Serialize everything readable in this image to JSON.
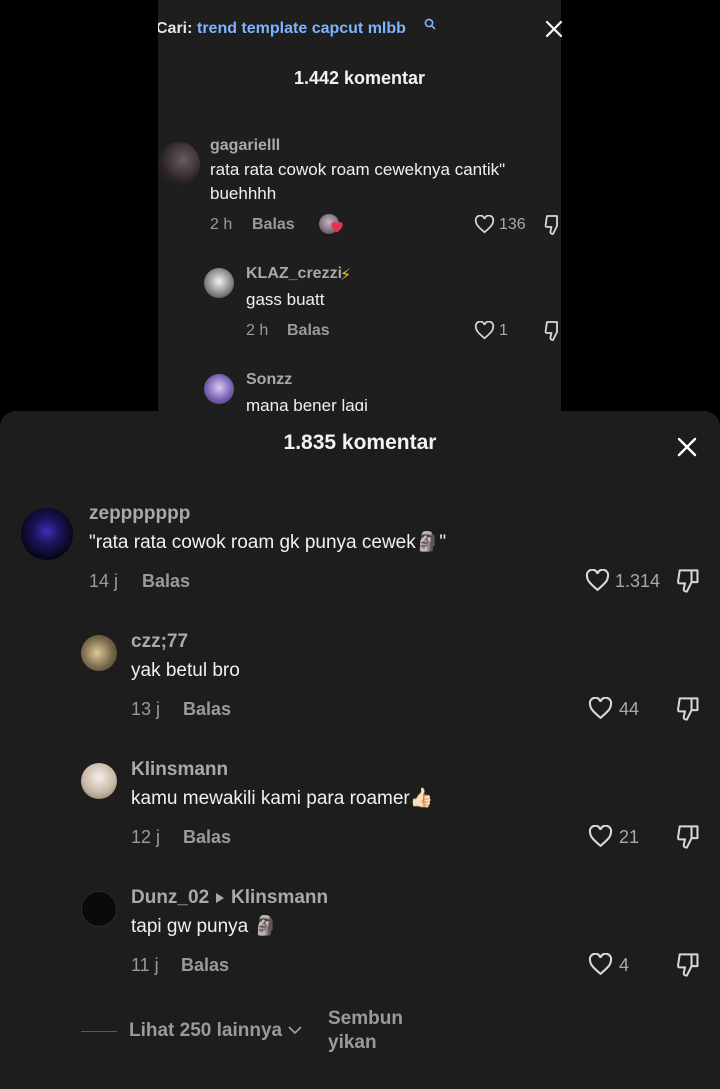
{
  "inner_screenshot": {
    "search": {
      "prefix": "Cari:",
      "term": "trend template capcut mlbb"
    },
    "title": "1.442 komentar",
    "comments": [
      {
        "username": "gagarielll",
        "text_lines": [
          "rata rata cowok roam ceweknya cantik\"",
          "buehhhh"
        ],
        "time": "2 h",
        "reply_label": "Balas",
        "likes": "136"
      },
      {
        "username": "KLAZ_crezzi",
        "badge": "⚡",
        "text_lines": [
          "gass buatt"
        ],
        "time": "2 h",
        "reply_label": "Balas",
        "likes": "1"
      },
      {
        "username": "Sonzz",
        "text_lines": [
          "mana bener lagi"
        ]
      }
    ]
  },
  "sheet": {
    "title": "1.835 komentar",
    "comments": [
      {
        "username": "zeppppppp",
        "text": "\"rata rata cowok roam gk punya cewek🗿\"",
        "time": "14 j",
        "reply_label": "Balas",
        "likes": "1.314"
      },
      {
        "username": "czz;77",
        "text": "yak betul bro",
        "time": "13 j",
        "reply_label": "Balas",
        "likes": "44"
      },
      {
        "username": "Klinsmann",
        "text": "kamu mewakili kami para roamer👍🏻",
        "time": "12 j",
        "reply_label": "Balas",
        "likes": "21"
      },
      {
        "username": "Dunz_02",
        "reply_to": "Klinsmann",
        "text": "tapi gw punya 🗿",
        "time": "11 j",
        "reply_label": "Balas",
        "likes": "4"
      }
    ],
    "view_more_label": "Lihat 250 lainnya",
    "hide_label_lines": [
      "Sembun",
      "yikan"
    ]
  },
  "colors": {
    "sheet_bg": "#1d1d1d",
    "search_term": "#7fb2ff",
    "meta_text": "#9a9a9a"
  },
  "icons": [
    "search-icon",
    "close-icon",
    "heart-icon",
    "dislike-icon",
    "chevron-down-icon",
    "lightning-icon"
  ]
}
